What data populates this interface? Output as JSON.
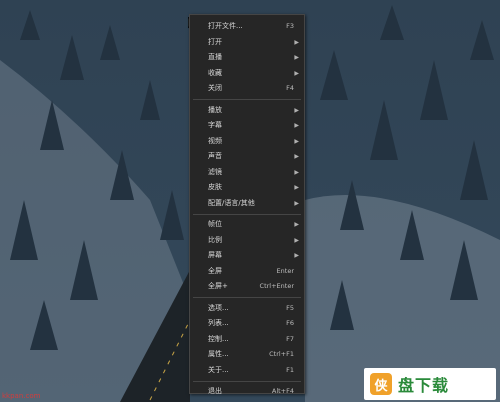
{
  "menu": {
    "groups": [
      [
        {
          "label": "打开文件...",
          "shortcut": "F3",
          "submenu": false
        },
        {
          "label": "打开",
          "shortcut": "",
          "submenu": true
        },
        {
          "label": "直播",
          "shortcut": "",
          "submenu": true
        },
        {
          "label": "收藏",
          "shortcut": "",
          "submenu": true
        },
        {
          "label": "关闭",
          "shortcut": "F4",
          "submenu": false
        }
      ],
      [
        {
          "label": "播放",
          "shortcut": "",
          "submenu": true
        },
        {
          "label": "字幕",
          "shortcut": "",
          "submenu": true
        },
        {
          "label": "视频",
          "shortcut": "",
          "submenu": true
        },
        {
          "label": "声音",
          "shortcut": "",
          "submenu": true
        },
        {
          "label": "滤镜",
          "shortcut": "",
          "submenu": true
        },
        {
          "label": "皮肤",
          "shortcut": "",
          "submenu": true
        },
        {
          "label": "配置/语言/其他",
          "shortcut": "",
          "submenu": true
        }
      ],
      [
        {
          "label": "帧位",
          "shortcut": "",
          "submenu": true
        },
        {
          "label": "比例",
          "shortcut": "",
          "submenu": true
        },
        {
          "label": "屏幕",
          "shortcut": "",
          "submenu": true
        },
        {
          "label": "全屏",
          "shortcut": "Enter",
          "submenu": false
        },
        {
          "label": "全屏+",
          "shortcut": "Ctrl+Enter",
          "submenu": false
        }
      ],
      [
        {
          "label": "选项...",
          "shortcut": "F5",
          "submenu": false
        },
        {
          "label": "列表...",
          "shortcut": "F6",
          "submenu": false
        },
        {
          "label": "控制...",
          "shortcut": "F7",
          "submenu": false
        },
        {
          "label": "属性...",
          "shortcut": "Ctrl+F1",
          "submenu": false
        },
        {
          "label": "关于...",
          "shortcut": "F1",
          "submenu": false
        }
      ],
      [
        {
          "label": "退出",
          "shortcut": "Alt+F4",
          "submenu": false
        }
      ]
    ],
    "arrow_glyph": "▶"
  },
  "watermark_left": "kkpan.com",
  "logo": {
    "badge": "侠",
    "text": "盘下载"
  },
  "colors": {
    "menu_bg": "#262626",
    "menu_text": "#d9d9d9",
    "accent_logo": "#f0a12a",
    "logo_text": "#2a8a3a"
  },
  "icons": [
    "mouse-cursor-icon",
    "submenu-arrow-icon"
  ]
}
